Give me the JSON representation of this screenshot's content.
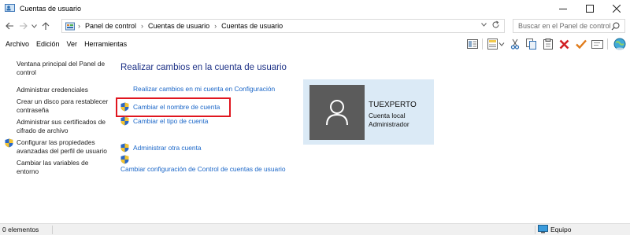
{
  "window": {
    "title": "Cuentas de usuario",
    "controls": [
      "minimize",
      "maximize",
      "close"
    ]
  },
  "address_bar": {
    "breadcrumbs": [
      "Panel de control",
      "Cuentas de usuario",
      "Cuentas de usuario"
    ],
    "search_placeholder": "Buscar en el Panel de control"
  },
  "menu": {
    "items": [
      "Archivo",
      "Edición",
      "Ver",
      "Herramientas"
    ]
  },
  "toolbar": {
    "icons": [
      "view-icon",
      "folder-options-icon",
      "cut-icon",
      "copy-icon",
      "paste-icon",
      "delete-icon",
      "checkmark-icon",
      "rename-icon",
      "globe-icon"
    ]
  },
  "left_pane": {
    "tasks": [
      "Ventana principal del Panel de control",
      "Administrar credenciales",
      "Crear un disco para restablecer contraseña",
      "Administrar sus certificados de cifrado de archivo",
      "Configurar las propiedades avanzadas del perfil de usuario",
      "Cambiar las variables de entorno"
    ]
  },
  "main": {
    "title": "Realizar cambios en la cuenta de usuario",
    "links": {
      "settings": "Realizar cambios en mi cuenta en Configuración",
      "rename": "Cambiar el nombre de cuenta",
      "change_type": "Cambiar el tipo de cuenta",
      "manage_other": "Administrar otra cuenta",
      "uac": "Cambiar configuración de Control de cuentas de usuario"
    }
  },
  "user": {
    "name": "TUEXPERTO",
    "account_type": "Cuenta local",
    "role": "Administrador"
  },
  "status": {
    "count": "0 elementos",
    "location": "Equipo"
  },
  "colors": {
    "title_blue": "#1e3287",
    "link_blue": "#1a66c8",
    "highlight_red": "#e0161f",
    "card_bg": "#dbeaf6"
  }
}
